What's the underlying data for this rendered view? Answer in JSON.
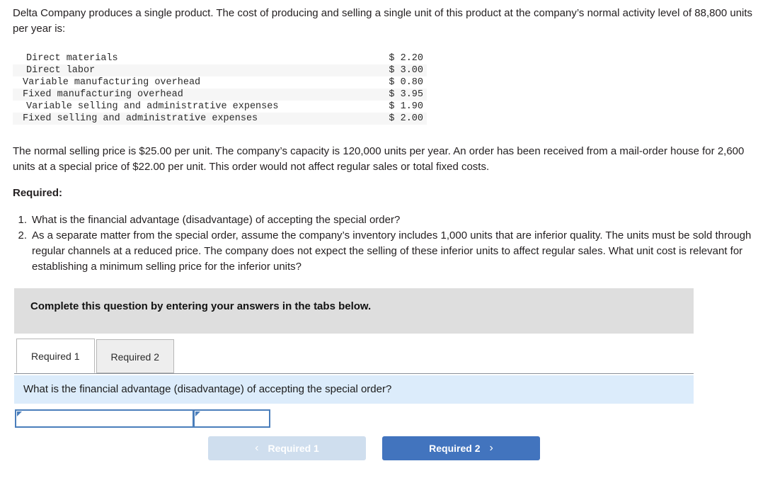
{
  "problem": {
    "intro": "Delta Company produces a single product. The cost of producing and selling a single unit of this product at the company’s normal activity level of 88,800 units per year is:",
    "cost_table": {
      "rows": [
        {
          "label": "Direct materials",
          "value": "$ 2.20"
        },
        {
          "label": "Direct labor",
          "value": "$ 3.00"
        },
        {
          "label": "Variable manufacturing overhead",
          "value": "$ 0.80"
        },
        {
          "label": "Fixed manufacturing overhead",
          "value": "$ 3.95"
        },
        {
          "label": "Variable selling and administrative expenses",
          "value": "$ 1.90"
        },
        {
          "label": "Fixed selling and administrative expenses",
          "value": "$ 2.00"
        }
      ]
    },
    "paragraph2": "The normal selling price is $25.00 per unit. The company’s capacity is 120,000 units per year. An order has been received from a mail-order house for 2,600 units at a special price of $22.00 per unit. This order would not affect regular sales or total fixed costs.",
    "required_heading": "Required:",
    "requirements": [
      {
        "num": "1.",
        "text": "What is the financial advantage (disadvantage) of accepting the special order?"
      },
      {
        "num": "2.",
        "text": "As a separate matter from the special order, assume the company’s inventory includes 1,000 units that are inferior quality. The units must be sold through regular channels at a reduced price. The company does not expect the selling of these inferior units to affect regular sales. What unit cost is relevant for establishing a minimum selling price for the inferior units?"
      }
    ]
  },
  "answer_panel": {
    "banner_text": "Complete this question by entering your answers in the tabs below.",
    "tabs": [
      {
        "label": "Required 1",
        "active": true
      },
      {
        "label": "Required 2",
        "active": false
      }
    ],
    "question_text": "What is the financial advantage (disadvantage) of accepting the special order?",
    "answer_cells": [
      {
        "value": "",
        "placeholder": ""
      },
      {
        "value": "",
        "placeholder": ""
      }
    ],
    "nav": {
      "prev_label": "Required 1",
      "prev_chevron": "‹",
      "next_label": "Required 2",
      "next_chevron": "›"
    }
  },
  "colors": {
    "banner_gray": "#dedede",
    "question_blue": "#dcecfb",
    "primary_blue": "#4274be",
    "disabled_blue": "#cfdeee",
    "cell_border": "#4a7ebb",
    "alt_row": "#f6f6f6"
  }
}
